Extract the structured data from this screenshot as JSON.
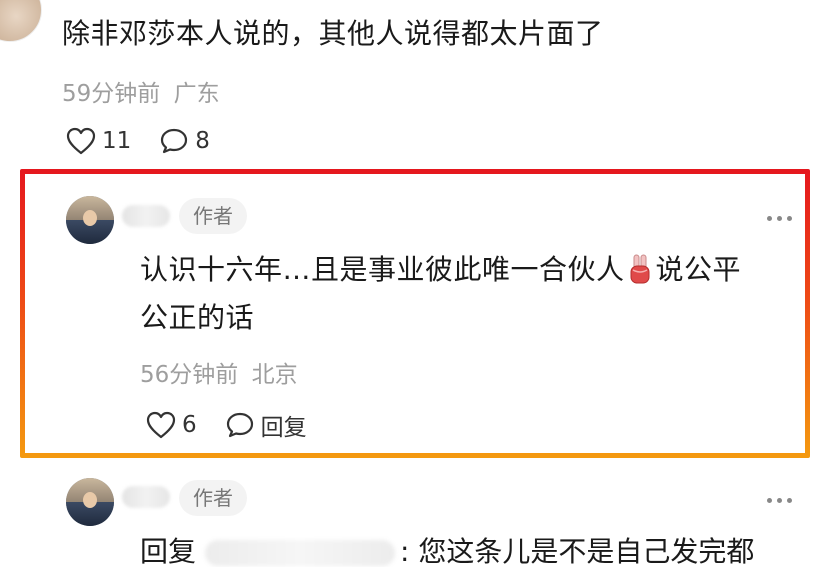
{
  "comments": [
    {
      "text": "除非邓莎本人说的，其他人说得都太片面了",
      "time": "59分钟前",
      "location": "广东",
      "likes": "11",
      "replies": "8"
    },
    {
      "author_badge": "作者",
      "text_line1_part1": "认识十六年…且是事业彼此唯一合伙人",
      "text_line1_part2": "说公平",
      "text_line2": "公正的话",
      "time": "56分钟前",
      "location": "北京",
      "likes": "6",
      "reply_label": "回复"
    },
    {
      "author_badge": "作者",
      "reply_prefix": "回复",
      "text": ": 您这条儿是不是自己发完都"
    }
  ],
  "icons": {
    "like": "heart-outline-icon",
    "comment": "speech-bubble-icon",
    "more": "more-dots-icon",
    "emoji": "victory-hand-emoji"
  },
  "colors": {
    "highlight_top": "#e5171e",
    "highlight_bottom": "#f49a10",
    "meta": "#9e9e9e",
    "badge_bg": "#f3f3f3"
  }
}
